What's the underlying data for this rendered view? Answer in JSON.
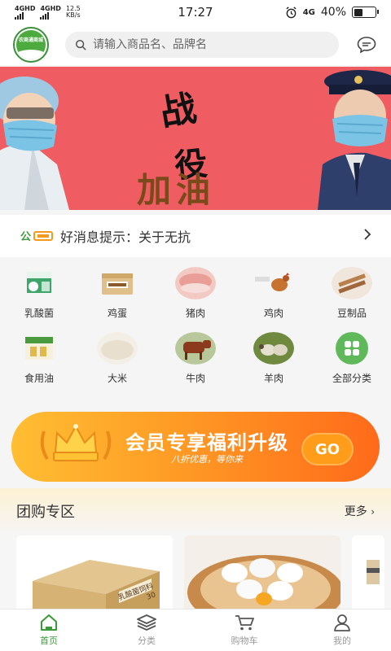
{
  "status_bar": {
    "net1": "4GHD",
    "net2": "4GHD",
    "speed_value": "12.5",
    "speed_unit": "KB/s",
    "time": "17:27",
    "net_right": "4G",
    "battery": "40%",
    "battery_level": 0.4
  },
  "header": {
    "logo_text": "农商通商城",
    "search_placeholder": "请输入商品名、品牌名"
  },
  "banner": {
    "title_line1": "战",
    "title_line2": "役",
    "slogan": "加油",
    "bg_color": "#ef5d63"
  },
  "notice": {
    "tag": "公告",
    "text": "好消息提示：关于无抗"
  },
  "categories": [
    {
      "label": "乳酸菌",
      "icon": "yogurt-box"
    },
    {
      "label": "鸡蛋",
      "icon": "egg-box"
    },
    {
      "label": "猪肉",
      "icon": "pork"
    },
    {
      "label": "鸡肉",
      "icon": "chicken"
    },
    {
      "label": "豆制品",
      "icon": "tofu"
    },
    {
      "label": "食用油",
      "icon": "oil-box"
    },
    {
      "label": "大米",
      "icon": "rice"
    },
    {
      "label": "牛肉",
      "icon": "cow"
    },
    {
      "label": "羊肉",
      "icon": "sheep"
    },
    {
      "label": "全部分类",
      "icon": "grid-four"
    }
  ],
  "member_banner": {
    "title": "会员专享福利升级",
    "subtitle": "八折优惠，等你来",
    "go": "GO"
  },
  "group_buy": {
    "title": "团购专区",
    "more": "更多",
    "products": [
      {
        "name": "box",
        "label": "乳酸菌饲料",
        "count": "30"
      },
      {
        "name": "eggs"
      }
    ]
  },
  "tabbar": {
    "tabs": [
      {
        "label": "首页",
        "icon": "home-icon",
        "active": true
      },
      {
        "label": "分类",
        "icon": "layers-icon",
        "active": false
      },
      {
        "label": "购物车",
        "icon": "cart-icon",
        "active": false
      },
      {
        "label": "我的",
        "icon": "user-icon",
        "active": false
      }
    ],
    "active_color": "#3a9a3a"
  }
}
